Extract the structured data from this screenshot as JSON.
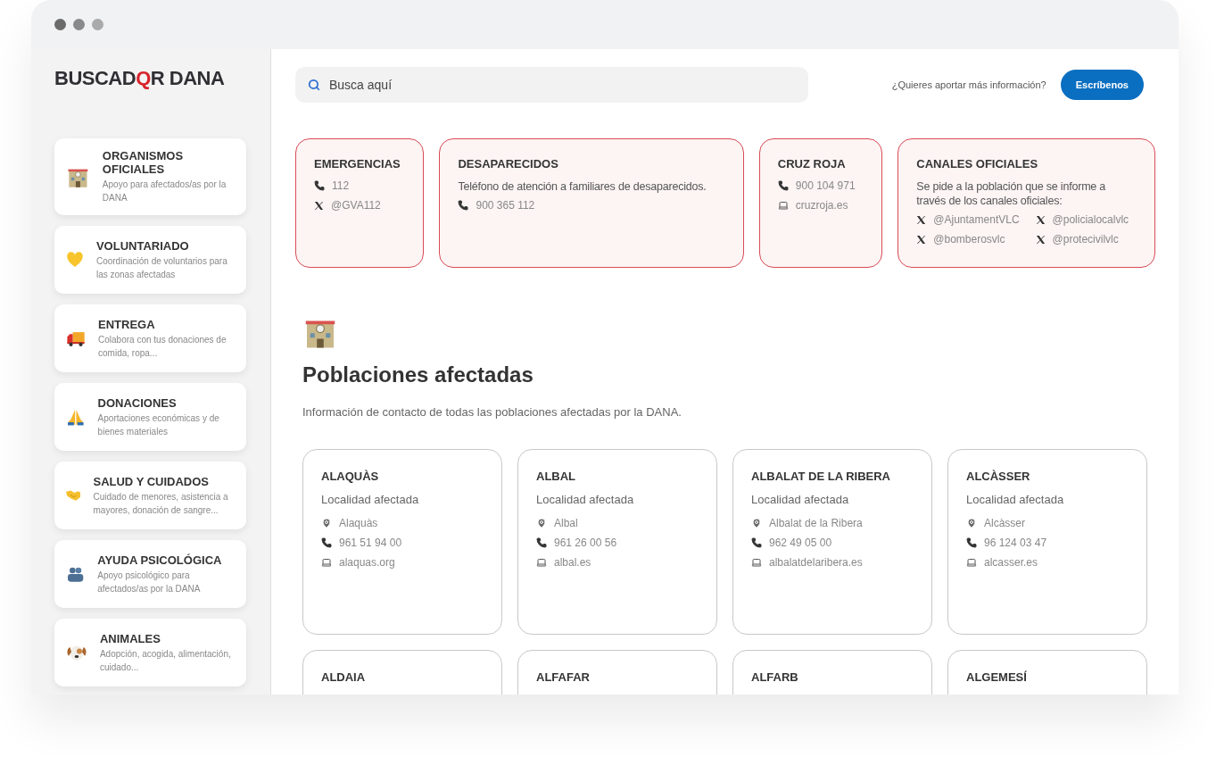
{
  "logo": {
    "start": "BUSCAD",
    "mark": "Q",
    "end": "R DANA"
  },
  "sidebar": {
    "items": [
      {
        "kind": "building",
        "title": "ORGANISMOS OFICIALES",
        "description": "Apoyo para afectados/as por la DANA"
      },
      {
        "kind": "heart",
        "title": "VOLUNTARIADO",
        "description": "Coordinación de voluntarios para las zonas afectadas"
      },
      {
        "kind": "truck",
        "title": "ENTREGA",
        "description": "Colabora con tus donaciones de comida, ropa..."
      },
      {
        "kind": "hands",
        "title": "DONACIONES",
        "description": "Aportaciones económicas y de bienes materiales"
      },
      {
        "kind": "handshake",
        "title": "SALUD Y CUIDADOS",
        "description": "Cuidado de menores, asistencia a mayores, donación de sangre..."
      },
      {
        "kind": "people",
        "title": "AYUDA PSICOLÓGICA",
        "description": "Apoyo psicológico para afectados/as por la DANA"
      },
      {
        "kind": "dog",
        "title": "ANIMALES",
        "description": "Adopción, acogida, alimentación, cuidado..."
      }
    ]
  },
  "search": {
    "placeholder": "Busca aquí"
  },
  "contact_prompt": "¿Quieres aportar más información?",
  "contact_button": "Escríbenos",
  "info_cards": [
    {
      "title": "EMERGENCIAS",
      "contacts": [
        {
          "kind": "phone",
          "text": "112"
        },
        {
          "kind": "x",
          "text": "@GVA112"
        }
      ]
    },
    {
      "title": "DESAPARECIDOS",
      "text": "Teléfono de atención a familiares de desaparecidos.",
      "contacts": [
        {
          "kind": "phone",
          "text": "900 365 112"
        }
      ]
    },
    {
      "title": "CRUZ ROJA",
      "contacts": [
        {
          "kind": "phone",
          "text": "900 104 971"
        },
        {
          "kind": "web",
          "text": "cruzroja.es"
        }
      ]
    },
    {
      "title": "CANALES OFICIALES",
      "text": "Se pide a la población que se informe a través de los canales oficiales:",
      "contacts": [
        {
          "kind": "x",
          "text": "@AjuntamentVLC"
        },
        {
          "kind": "x",
          "text": "@policialocalvlc"
        },
        {
          "kind": "x",
          "text": "@bomberosvlc"
        },
        {
          "kind": "x",
          "text": "@protecivilvlc"
        }
      ]
    }
  ],
  "section": {
    "title": "Poblaciones afectadas",
    "description": "Información de contacto de todas las poblaciones afectadas por la DANA."
  },
  "towns": [
    {
      "name": "ALAQUÀS",
      "subtitle": "Localidad afectada",
      "contacts": [
        {
          "kind": "location",
          "text": "Alaquàs"
        },
        {
          "kind": "phone",
          "text": "961 51 94 00"
        },
        {
          "kind": "web",
          "text": "alaquas.org"
        }
      ]
    },
    {
      "name": "ALBAL",
      "subtitle": "Localidad afectada",
      "contacts": [
        {
          "kind": "location",
          "text": "Albal"
        },
        {
          "kind": "phone",
          "text": "961 26 00 56"
        },
        {
          "kind": "web",
          "text": "albal.es"
        }
      ]
    },
    {
      "name": "ALBALAT DE LA RIBERA",
      "subtitle": "Localidad afectada",
      "contacts": [
        {
          "kind": "location",
          "text": "Albalat de la Ribera"
        },
        {
          "kind": "phone",
          "text": "962 49 05 00"
        },
        {
          "kind": "web",
          "text": "albalatdelaribera.es"
        }
      ]
    },
    {
      "name": "ALCÀSSER",
      "subtitle": "Localidad afectada",
      "contacts": [
        {
          "kind": "location",
          "text": "Alcàsser"
        },
        {
          "kind": "phone",
          "text": "96 124 03 47"
        },
        {
          "kind": "web",
          "text": "alcasser.es"
        }
      ]
    },
    {
      "name": "ALDAIA"
    },
    {
      "name": "ALFAFAR"
    },
    {
      "name": "ALFARB"
    },
    {
      "name": "ALGEMESÍ"
    }
  ]
}
